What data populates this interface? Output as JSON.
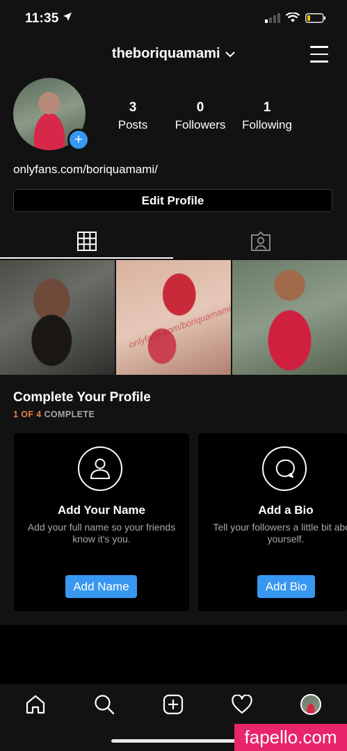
{
  "status_bar": {
    "time": "11:35"
  },
  "header": {
    "username": "theboriquamami",
    "chevron": "⌄"
  },
  "stats": [
    {
      "num": "3",
      "label": "Posts"
    },
    {
      "num": "0",
      "label": "Followers"
    },
    {
      "num": "1",
      "label": "Following"
    }
  ],
  "bio": {
    "link": "onlyfans.com/boriquamami/"
  },
  "edit_profile": {
    "label": "Edit Profile"
  },
  "photo_text": "onlyfans.com/boriquamami",
  "complete_profile": {
    "title": "Complete Your Profile",
    "progress_highlight": "1 OF 4",
    "progress_rest": " COMPLETE",
    "cards": [
      {
        "icon": "person-icon",
        "title": "Add Your Name",
        "desc": "Add your full name so your friends know it's you.",
        "button": "Add Name"
      },
      {
        "icon": "speech-bubble-icon",
        "title": "Add a Bio",
        "desc": "Tell your followers a little bit about yourself.",
        "button": "Add Bio"
      }
    ]
  },
  "watermark": "fapello.com",
  "colors": {
    "accent": "#3897f0",
    "progress": "#ed7d45",
    "watermark": "#e8246a"
  }
}
